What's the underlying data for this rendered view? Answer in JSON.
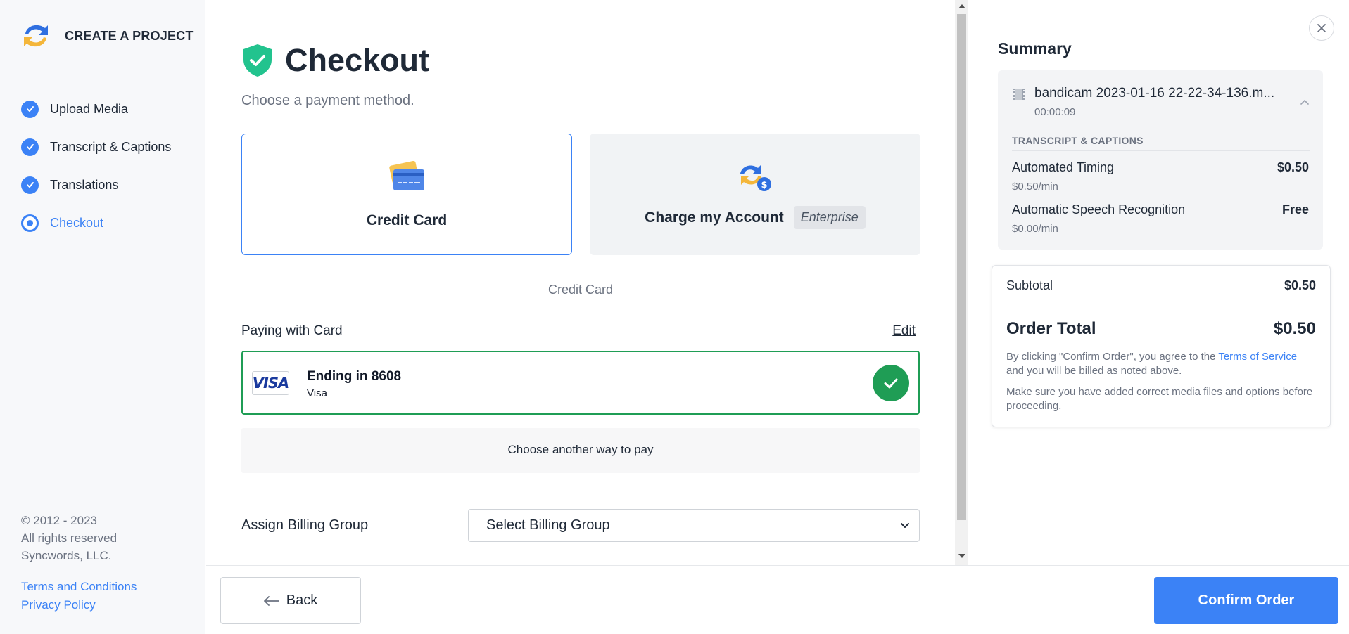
{
  "sidebar": {
    "brand": "CREATE A PROJECT",
    "steps": [
      {
        "label": "Upload Media"
      },
      {
        "label": "Transcript & Captions"
      },
      {
        "label": "Translations"
      },
      {
        "label": "Checkout"
      }
    ],
    "footer": {
      "copyright": "© 2012 - 2023",
      "rights": "All rights reserved",
      "company": "Syncwords, LLC."
    },
    "links": {
      "terms": "Terms and Conditions",
      "privacy": "Privacy Policy"
    }
  },
  "main": {
    "title": "Checkout",
    "subtitle": "Choose a payment method.",
    "methods": {
      "credit": "Credit Card",
      "account": "Charge my Account",
      "account_badge": "Enterprise"
    },
    "divider": "Credit Card",
    "paying_label": "Paying with Card",
    "edit": "Edit",
    "card": {
      "brand": "VISA",
      "title": "Ending in 8608",
      "type": "Visa"
    },
    "another_way": "Choose another way to pay",
    "billing": {
      "label": "Assign Billing Group",
      "selected": "Select Billing Group"
    }
  },
  "footer": {
    "back": "Back",
    "confirm": "Confirm Order"
  },
  "summary": {
    "title": "Summary",
    "media": {
      "name": "bandicam 2023-01-16 22-22-34-136.m...",
      "duration": "00:00:09"
    },
    "section": "TRANSCRIPT & CAPTIONS",
    "items": [
      {
        "name": "Automated Timing",
        "rate": "$0.50/min",
        "price": "$0.50"
      },
      {
        "name": "Automatic Speech Recognition",
        "rate": "$0.00/min",
        "price": "Free"
      }
    ],
    "subtotal_label": "Subtotal",
    "subtotal": "$0.50",
    "total_label": "Order Total",
    "total": "$0.50",
    "terms_pre": "By clicking \"Confirm Order\", you agree to the",
    "terms_link": "Terms of Service",
    "terms_post": "and you will be billed as noted above.",
    "note": "Make sure you have added correct media files and options before proceeding."
  },
  "colors": {
    "accent": "#3b82f6",
    "success": "#1f9d55",
    "logo_blue": "#2f6fe0",
    "logo_yellow": "#f4b63a"
  }
}
